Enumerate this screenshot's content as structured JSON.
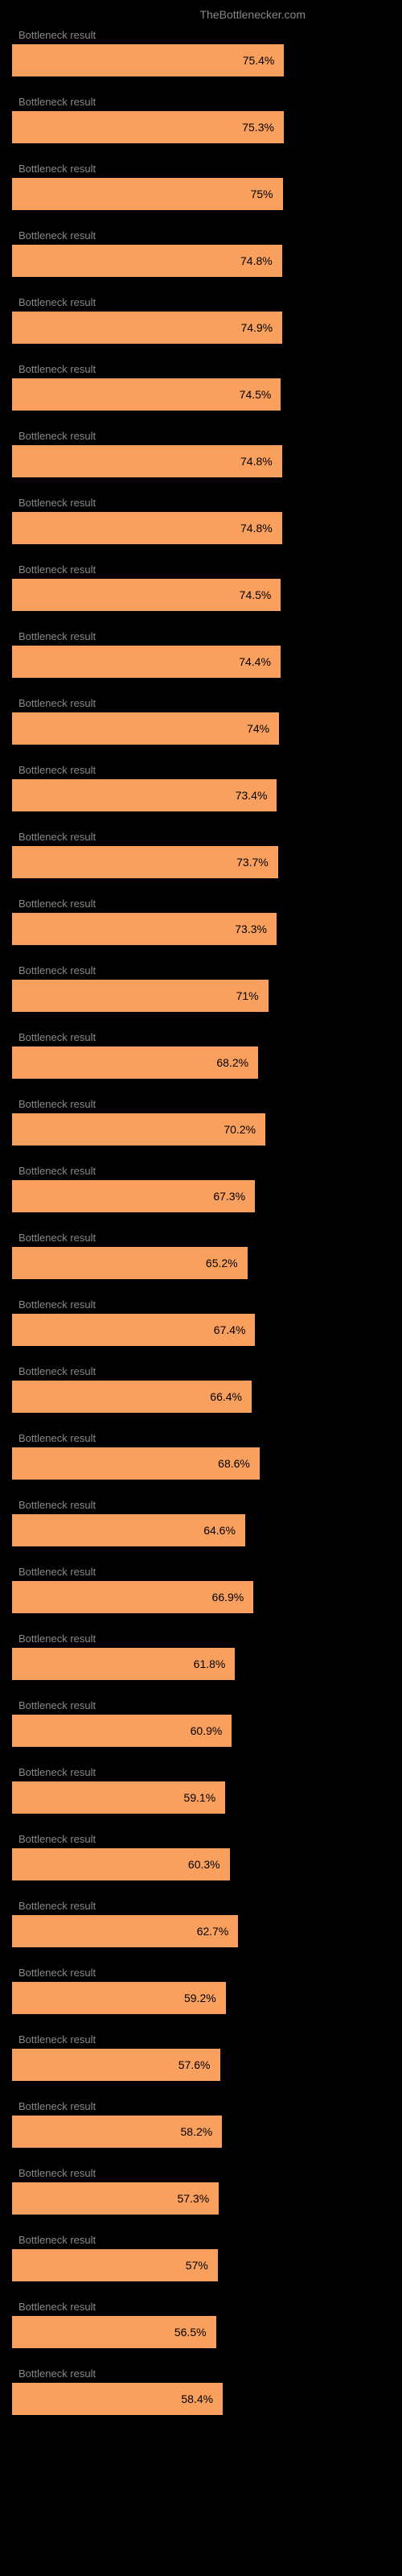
{
  "header": {
    "brand": "TheBottlenecker.com"
  },
  "chart_data": {
    "type": "bar",
    "title": "",
    "xlabel": "",
    "ylabel": "",
    "max_width_percent": 72,
    "bar_color": "#f9a05f",
    "series": [
      {
        "label": "Bottleneck result",
        "value": 75.4
      },
      {
        "label": "Bottleneck result",
        "value": 75.3
      },
      {
        "label": "Bottleneck result",
        "value": 75.0,
        "display": "75%"
      },
      {
        "label": "Bottleneck result",
        "value": 74.8
      },
      {
        "label": "Bottleneck result",
        "value": 74.9
      },
      {
        "label": "Bottleneck result",
        "value": 74.5
      },
      {
        "label": "Bottleneck result",
        "value": 74.8
      },
      {
        "label": "Bottleneck result",
        "value": 74.8
      },
      {
        "label": "Bottleneck result",
        "value": 74.5
      },
      {
        "label": "Bottleneck result",
        "value": 74.4
      },
      {
        "label": "Bottleneck result",
        "value": 74.0,
        "display": "74%"
      },
      {
        "label": "Bottleneck result",
        "value": 73.4
      },
      {
        "label": "Bottleneck result",
        "value": 73.7
      },
      {
        "label": "Bottleneck result",
        "value": 73.3
      },
      {
        "label": "Bottleneck result",
        "value": 71.0,
        "display": "71%"
      },
      {
        "label": "Bottleneck result",
        "value": 68.2
      },
      {
        "label": "Bottleneck result",
        "value": 70.2
      },
      {
        "label": "Bottleneck result",
        "value": 67.3
      },
      {
        "label": "Bottleneck result",
        "value": 65.2
      },
      {
        "label": "Bottleneck result",
        "value": 67.4
      },
      {
        "label": "Bottleneck result",
        "value": 66.4
      },
      {
        "label": "Bottleneck result",
        "value": 68.6
      },
      {
        "label": "Bottleneck result",
        "value": 64.6
      },
      {
        "label": "Bottleneck result",
        "value": 66.9
      },
      {
        "label": "Bottleneck result",
        "value": 61.8
      },
      {
        "label": "Bottleneck result",
        "value": 60.9
      },
      {
        "label": "Bottleneck result",
        "value": 59.1
      },
      {
        "label": "Bottleneck result",
        "value": 60.3
      },
      {
        "label": "Bottleneck result",
        "value": 62.7
      },
      {
        "label": "Bottleneck result",
        "value": 59.2
      },
      {
        "label": "Bottleneck result",
        "value": 57.6
      },
      {
        "label": "Bottleneck result",
        "value": 58.2
      },
      {
        "label": "Bottleneck result",
        "value": 57.3
      },
      {
        "label": "Bottleneck result",
        "value": 57.0,
        "display": "57%"
      },
      {
        "label": "Bottleneck result",
        "value": 56.5
      },
      {
        "label": "Bottleneck result",
        "value": 58.4
      }
    ]
  }
}
